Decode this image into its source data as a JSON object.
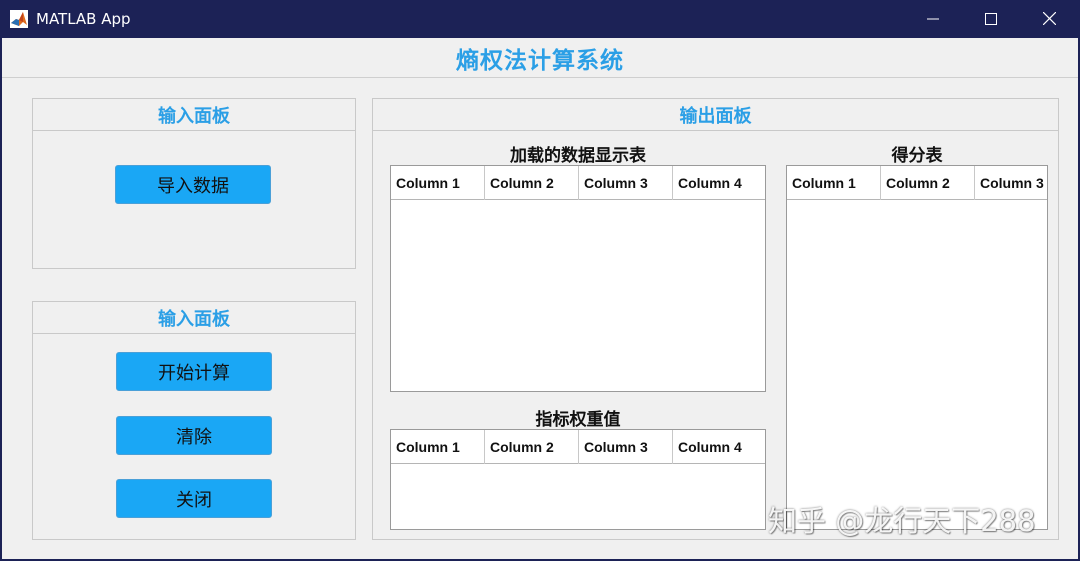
{
  "window": {
    "title": "MATLAB App",
    "icon": "matlab-logo-icon",
    "controls": [
      "minimize-icon",
      "maximize-icon",
      "close-icon"
    ]
  },
  "app": {
    "title": "熵权法计算系统",
    "accent_color": "#2b9fe6",
    "button_color": "#1aa7f5"
  },
  "input_panel_top": {
    "title": "输入面板",
    "import_button": "导入数据"
  },
  "input_panel_bottom": {
    "title": "输入面板",
    "start_button": "开始计算",
    "clear_button": "清除",
    "close_button": "关闭"
  },
  "output_panel": {
    "title": "输出面板",
    "data_table": {
      "title": "加载的数据显示表",
      "columns": [
        "Column 1",
        "Column 2",
        "Column 3",
        "Column 4"
      ]
    },
    "weight_table": {
      "title": "指标权重值",
      "columns": [
        "Column 1",
        "Column 2",
        "Column 3",
        "Column 4"
      ]
    },
    "score_table": {
      "title": "得分表",
      "columns": [
        "Column 1",
        "Column 2",
        "Column 3"
      ]
    }
  },
  "watermark": "知乎 @龙行天下288"
}
